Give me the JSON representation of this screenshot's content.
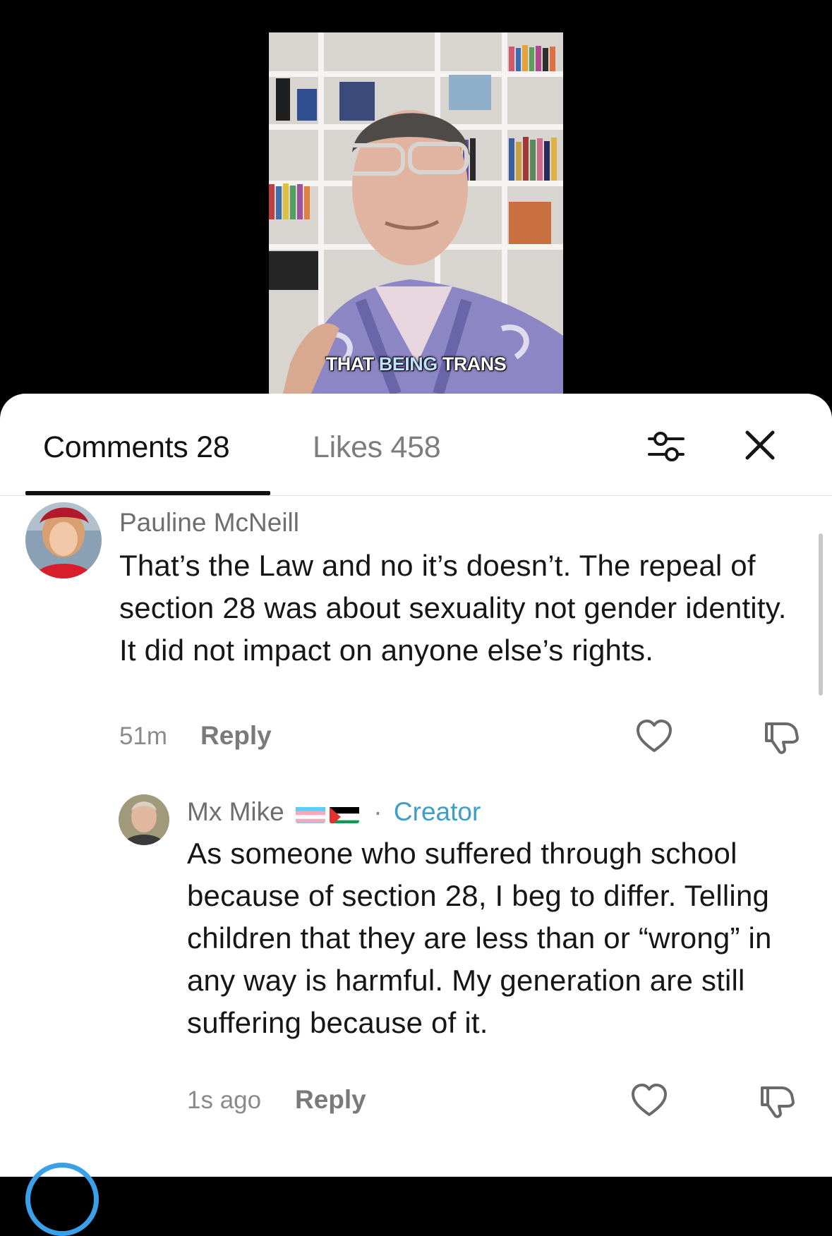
{
  "video": {
    "caption_parts": [
      "THAT ",
      "BEING",
      " TRANS"
    ]
  },
  "tabs": {
    "comments_label": "Comments 28",
    "likes_label": "Likes 458"
  },
  "icons": {
    "filter": "sliders-icon",
    "close": "close-icon",
    "like": "heart-icon",
    "dislike": "thumbs-down-icon"
  },
  "comments": [
    {
      "username": "Pauline McNeill",
      "text": "That’s the Law and no it’s doesn’t. The repeal of section 28 was about sexuality not gender identity. It did not impact on anyone else’s rights.",
      "time": "51m",
      "reply_label": "Reply"
    }
  ],
  "reply": {
    "username": "Mx Mike",
    "separator": "·",
    "badge": "Creator",
    "text": "As someone who suffered through school because of section 28, I beg to differ. Telling children that they are less than or “wrong” in any way is harmful. My generation are still suffering because of it.",
    "time": "1s ago",
    "reply_label": "Reply"
  },
  "colors": {
    "creator_badge": "#3f9ec4",
    "tab_active": "#111111",
    "tab_inactive": "#7d7d7d",
    "story_ring": "#3aa0e8"
  }
}
